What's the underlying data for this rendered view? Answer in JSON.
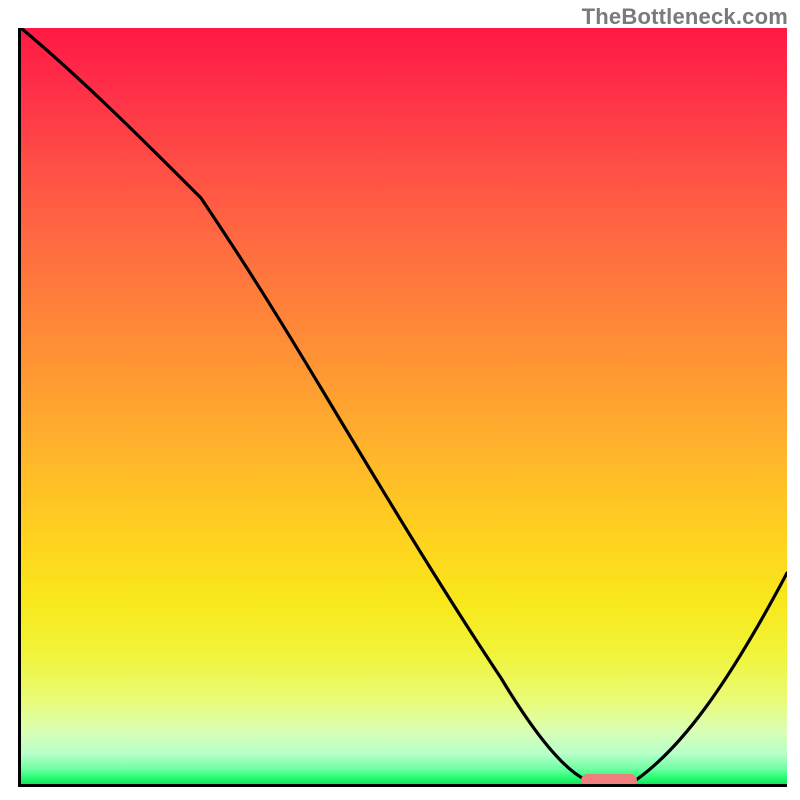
{
  "watermark": "TheBottleneck.com",
  "chart_data": {
    "type": "line",
    "title": "",
    "xlabel": "",
    "ylabel": "",
    "xlim": [
      0,
      100
    ],
    "ylim": [
      0,
      100
    ],
    "grid": false,
    "legend": false,
    "background": "heatmap-gradient-red-to-green",
    "series": [
      {
        "name": "bottleneck-curve",
        "x": [
          0,
          10,
          20,
          30,
          40,
          50,
          60,
          65,
          70,
          75,
          80,
          85,
          90,
          95,
          100
        ],
        "values": [
          100,
          93,
          83,
          68,
          53,
          38,
          23,
          14,
          5,
          1,
          0,
          5,
          12,
          20,
          28
        ]
      }
    ],
    "annotations": [
      {
        "name": "optimal-marker",
        "shape": "rounded-bar",
        "color": "#ef7f7f",
        "x_range": [
          73,
          80
        ],
        "y": 0
      }
    ]
  }
}
